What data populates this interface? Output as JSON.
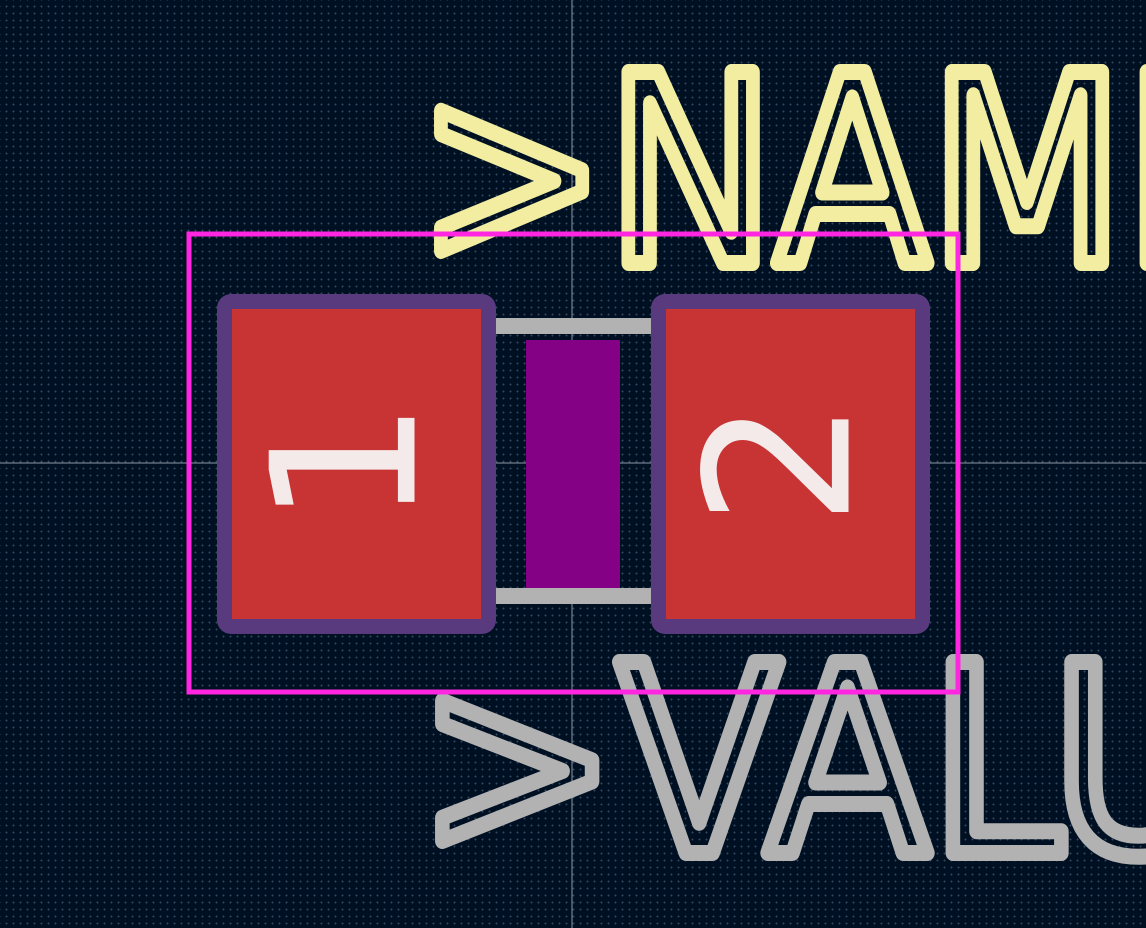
{
  "footprint": {
    "name_field": ">NAME",
    "value_field": ">VALUE",
    "pads": [
      {
        "number": "1"
      },
      {
        "number": "2"
      }
    ]
  },
  "colors": {
    "background": "#001023",
    "grid_dot": "#33465e",
    "crosshair": "#c8d0dc",
    "courtyard": "#ff26e2",
    "name_text": "#f2eda1",
    "value_text": "#b2b2b2",
    "pad_copper": "#c83434",
    "pad_mask": "#5a3a7e",
    "pad_number": "#f5eaea",
    "body": "#840084",
    "fab_outline": "#b2b2b2"
  }
}
